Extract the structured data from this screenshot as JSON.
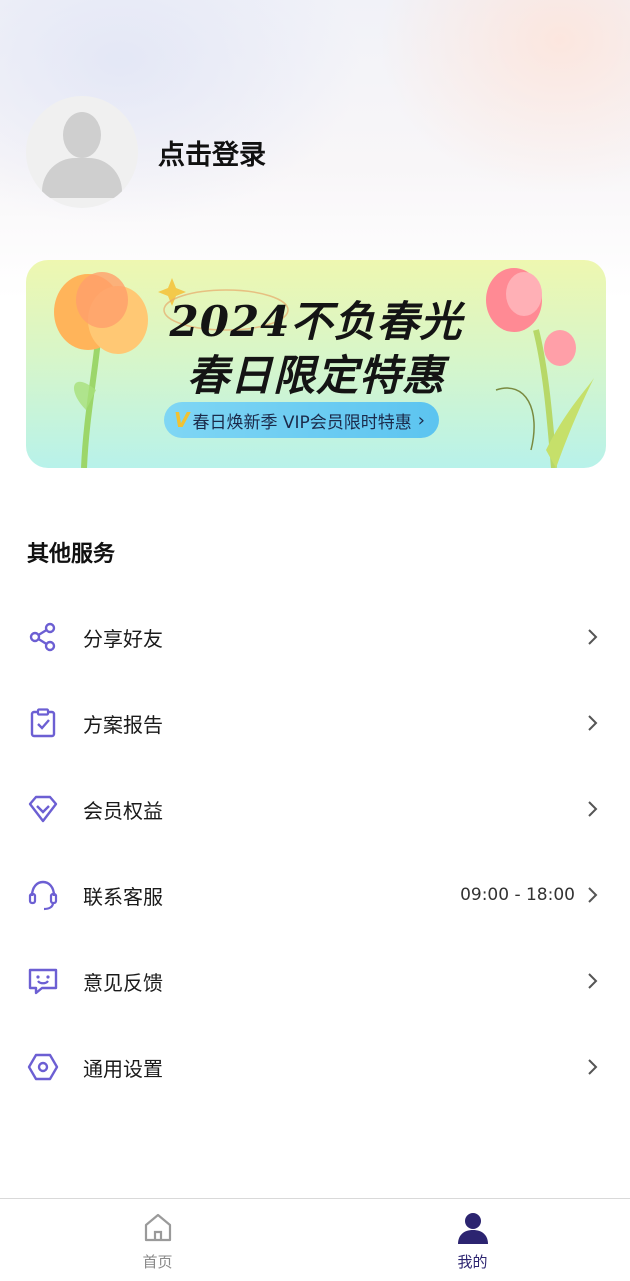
{
  "profile": {
    "login_text": "点击登录",
    "avatar_icon": "person-placeholder-icon"
  },
  "banner": {
    "line1": "2024不负春光",
    "line2": "春日限定特惠",
    "pill_badge": "V",
    "pill_text": "春日焕新季 VIP会员限时特惠",
    "pill_arrow": "›"
  },
  "services": {
    "title": "其他服务",
    "items": [
      {
        "label": "分享好友",
        "icon": "share-icon",
        "extra": ""
      },
      {
        "label": "方案报告",
        "icon": "clipboard-check-icon",
        "extra": ""
      },
      {
        "label": "会员权益",
        "icon": "diamond-icon",
        "extra": ""
      },
      {
        "label": "联系客服",
        "icon": "headset-icon",
        "extra": "09:00 - 18:00"
      },
      {
        "label": "意见反馈",
        "icon": "feedback-smile-icon",
        "extra": ""
      },
      {
        "label": "通用设置",
        "icon": "settings-hex-icon",
        "extra": ""
      }
    ]
  },
  "nav": {
    "tabs": [
      {
        "label": "首页",
        "icon": "home-icon",
        "active": false
      },
      {
        "label": "我的",
        "icon": "user-icon",
        "active": true
      }
    ]
  },
  "colors": {
    "accent": "#6c5fd3",
    "nav_active": "#2c2470",
    "nav_inactive": "#8a8a8a"
  }
}
